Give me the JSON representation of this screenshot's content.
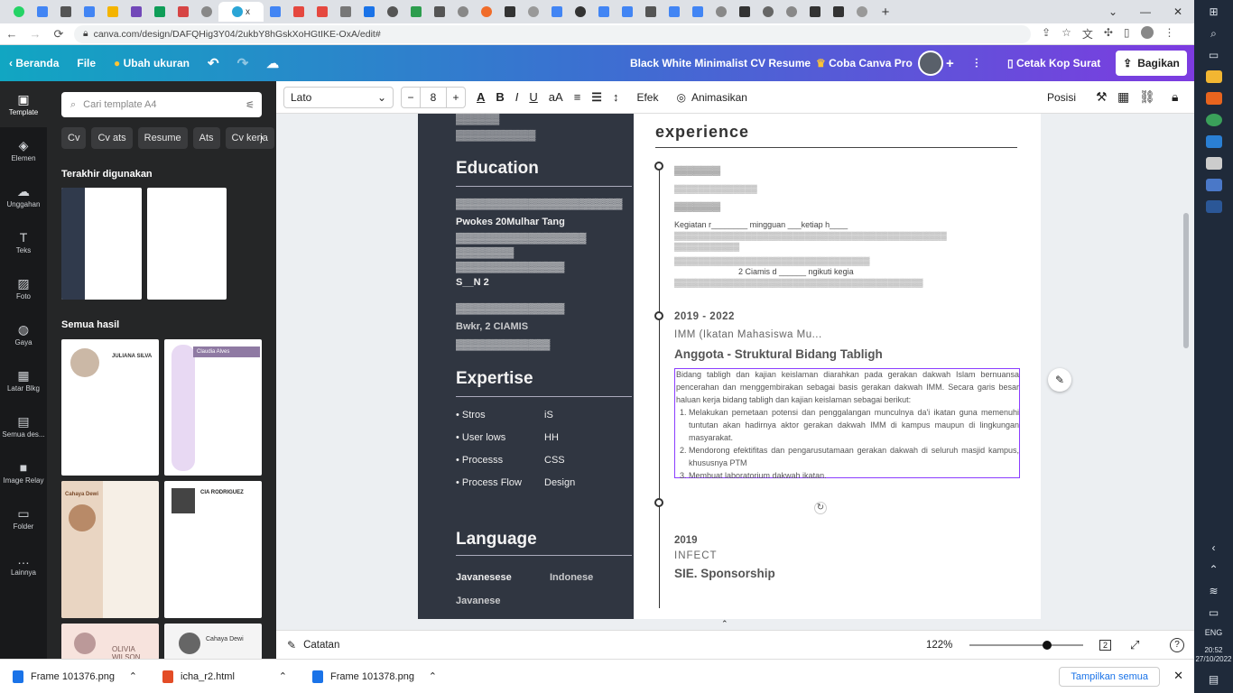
{
  "browser": {
    "url": "canva.com/design/DAFQHig3Y04/2ukbY8hGskXoHGtIKE-OxA/edit#",
    "active_tab_label": "x"
  },
  "header": {
    "home": "Beranda",
    "file": "File",
    "resize": "Ubah ukuran",
    "doc_title": "Black White Minimalist CV Resume",
    "try_pro": "Coba Canva Pro",
    "print": "Cetak Kop Surat",
    "share": "Bagikan"
  },
  "rail": [
    {
      "label": "Template",
      "icon": "template-icon"
    },
    {
      "label": "Elemen",
      "icon": "elements-icon"
    },
    {
      "label": "Unggahan",
      "icon": "upload-icon"
    },
    {
      "label": "Teks",
      "icon": "text-icon"
    },
    {
      "label": "Foto",
      "icon": "photo-icon"
    },
    {
      "label": "Gaya",
      "icon": "styles-icon"
    },
    {
      "label": "Latar Blkg",
      "icon": "background-icon"
    },
    {
      "label": "Semua des...",
      "icon": "all-designs-icon"
    },
    {
      "label": "Image Relay",
      "icon": "image-relay-icon"
    },
    {
      "label": "Folder",
      "icon": "folder-icon"
    },
    {
      "label": "Lainnya",
      "icon": "more-icon"
    }
  ],
  "panel": {
    "search_placeholder": "Cari template A4",
    "chips": [
      "Cv",
      "Cv ats",
      "Resume",
      "Ats",
      "Cv kerja"
    ],
    "recent_title": "Terakhir digunakan",
    "all_title": "Semua hasil",
    "thumbs": [
      {
        "name": "JULIANA SILVA"
      },
      {
        "name": "Claudia Alves"
      },
      {
        "name": "Cahaya Dewi"
      },
      {
        "name": "CIA RODRIGUEZ"
      },
      {
        "name": "OLIVIA WILSON"
      },
      {
        "name": "Cahaya Dewi"
      }
    ]
  },
  "toolbar": {
    "font": "Lato",
    "size": "8",
    "effects": "Efek",
    "animate": "Animasikan",
    "position": "Posisi"
  },
  "resume": {
    "side": {
      "education": "Education",
      "edu_line1": "Pwokes 20Mulhar Tang",
      "edu_line2": "S__N 2",
      "edu_line3": "Bwkr, 2 CIAMIS",
      "expertise": "Expertise",
      "skills_left": [
        "Stros",
        "User lows",
        "Processs",
        "Process Flow"
      ],
      "skills_right": [
        "iS",
        "HH",
        "CSS",
        "Design"
      ],
      "language": "Language",
      "lang1": "Javanesese",
      "lang2": "Indonese",
      "lang3": "Javanese"
    },
    "main": {
      "heading": "experience",
      "period": "2019 - 2022",
      "org": "IMM (Ikatan Mahasiswa Mu...",
      "role": "Anggota - Struktural Bidang Tabligh",
      "paragraph": "Bidang tabligh dan kajian keislaman diarahkan pada gerakan dakwah Islam bernuansa pencerahan dan menggembirakan sebagai basis gerakan dakwah IMM. Secara garis besar haluan kerja bidang tabligh dan kajian keislaman sebagai berikut:",
      "items": [
        "Melakukan pemetaan potensi dan penggalangan munculnya da'i ikatan guna memenuhi tuntutan akan hadirnya aktor gerakan dakwah IMM di kampus maupun di lingkungan masyarakat.",
        "Mendorong efektifitas dan pengarusutamaan gerakan dakwah di seluruh masjid kampus, khususnya PTM",
        "Membuat laboratorium dakwah ikatan."
      ],
      "year2": "2019",
      "org2": "INFECT",
      "role2": "SIE. Sponsorship",
      "blur1": "Kegiatan r________ mingguan ___ketiap h____",
      "blur2": "2 Ciamis d ______ ngikuti kegia"
    }
  },
  "bottom": {
    "notes": "Catatan",
    "zoom": "122%",
    "zoom_level": 0.68
  },
  "downloads": [
    {
      "name": "Frame 101376.png"
    },
    {
      "name": "icha_r2.html"
    },
    {
      "name": "Frame 101378.png"
    }
  ],
  "downloads_show_all": "Tampilkan semua",
  "system": {
    "lang": "ENG",
    "time": "20:52",
    "date": "27/10/2022"
  }
}
